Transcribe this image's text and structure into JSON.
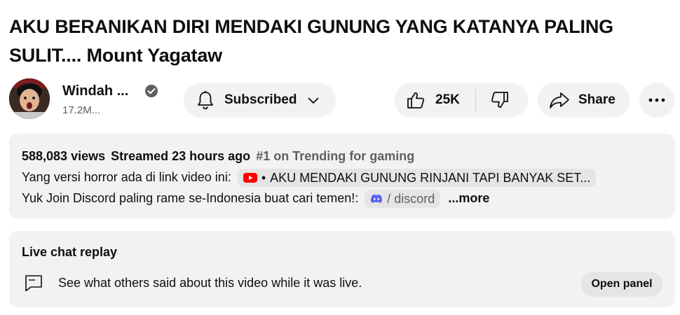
{
  "video": {
    "title": "AKU BERANIKAN DIRI MENDAKI GUNUNG YANG KATANYA PALING SULIT.... Mount Yagataw"
  },
  "channel": {
    "name": "Windah ...",
    "subscribers": "17.2M..."
  },
  "actions": {
    "subscribe_label": "Subscribed",
    "like_count": "25K",
    "share_label": "Share"
  },
  "description": {
    "views": "588,083 views",
    "streamed": "Streamed 23 hours ago",
    "trending": "#1 on Trending for gaming",
    "line1_text": "Yang versi horror ada di link video ini:",
    "line1_link": "AKU MENDAKI GUNUNG RINJANI TAPI BANYAK SET...",
    "line2_text": "Yuk Join Discord paling rame se-Indonesia buat cari temen!:",
    "line2_link": "/ discord",
    "more_label": "...more"
  },
  "live_chat": {
    "title": "Live chat replay",
    "text": "See what others said about this video while it was live.",
    "button_label": "Open panel"
  },
  "colors": {
    "youtube_red": "#ff0000",
    "discord_blue": "#5865f2",
    "pill_bg": "#f2f2f2"
  }
}
